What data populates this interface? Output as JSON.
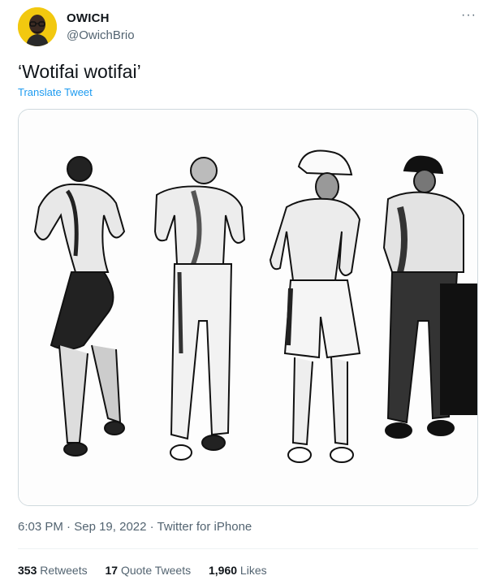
{
  "author": {
    "name": "OWICH",
    "handle": "@OwichBrio"
  },
  "tweet": {
    "text": "‘Wotifai wotifai’",
    "translate_label": "Translate Tweet"
  },
  "meta": {
    "time": "6:03 PM",
    "sep1": " · ",
    "date": "Sep 19, 2022",
    "sep2": " · ",
    "source": "Twitter for iPhone"
  },
  "stats": {
    "retweets": "353",
    "retweets_label": " Retweets",
    "quotes": "17",
    "quotes_label": " Quote Tweets",
    "likes": "1,960",
    "likes_label": " Likes"
  },
  "more_icon": "···",
  "colors": {
    "link": "#1d9bf0",
    "secondary": "#536471",
    "avatar_bg": "#f2c80f"
  }
}
